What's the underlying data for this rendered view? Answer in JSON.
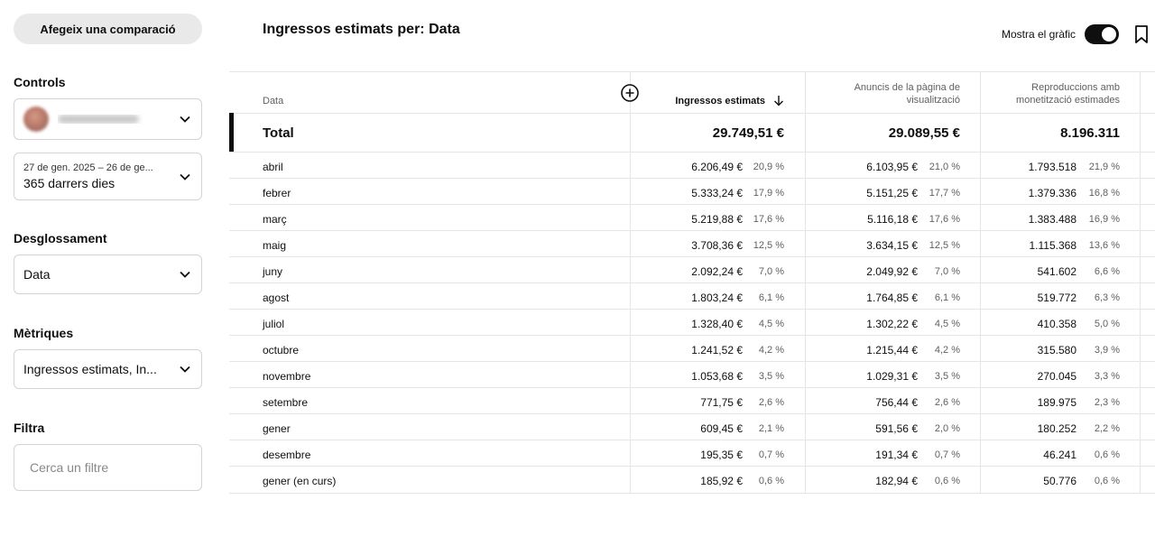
{
  "sidebar": {
    "compare_button": "Afegeix una comparació",
    "controls_label": "Controls",
    "date_range": {
      "range_text": "27 de gen. 2025 – 26 de ge...",
      "period": "365 darrers dies"
    },
    "breakdown_label": "Desglossament",
    "breakdown_value": "Data",
    "metrics_label": "Mètriques",
    "metrics_value": "Ingressos estimats, In...",
    "filter_label": "Filtra",
    "filter_placeholder": "Cerca un filtre"
  },
  "header": {
    "title": "Ingressos estimats per: Data",
    "show_chart_label": "Mostra el gràfic",
    "show_chart_on": true
  },
  "table": {
    "col_date": "Data",
    "col_revenue": "Ingressos estimats",
    "col_watch_ads_l1": "Anuncis de la pàgina de",
    "col_watch_ads_l2": "visualització",
    "col_monet_l1": "Reproduccions amb",
    "col_monet_l2": "monetització estimades",
    "total": {
      "label": "Total",
      "revenue": "29.749,51 €",
      "watch_ads": "29.089,55 €",
      "monet": "8.196.311"
    },
    "rows": [
      {
        "label": "abril",
        "rev": "6.206,49 €",
        "rev_pct": "20,9 %",
        "ads": "6.103,95 €",
        "ads_pct": "21,0 %",
        "mon": "1.793.518",
        "mon_pct": "21,9 %"
      },
      {
        "label": "febrer",
        "rev": "5.333,24 €",
        "rev_pct": "17,9 %",
        "ads": "5.151,25 €",
        "ads_pct": "17,7 %",
        "mon": "1.379.336",
        "mon_pct": "16,8 %"
      },
      {
        "label": "març",
        "rev": "5.219,88 €",
        "rev_pct": "17,6 %",
        "ads": "5.116,18 €",
        "ads_pct": "17,6 %",
        "mon": "1.383.488",
        "mon_pct": "16,9 %"
      },
      {
        "label": "maig",
        "rev": "3.708,36 €",
        "rev_pct": "12,5 %",
        "ads": "3.634,15 €",
        "ads_pct": "12,5 %",
        "mon": "1.115.368",
        "mon_pct": "13,6 %"
      },
      {
        "label": "juny",
        "rev": "2.092,24 €",
        "rev_pct": "7,0 %",
        "ads": "2.049,92 €",
        "ads_pct": "7,0 %",
        "mon": "541.602",
        "mon_pct": "6,6 %"
      },
      {
        "label": "agost",
        "rev": "1.803,24 €",
        "rev_pct": "6,1 %",
        "ads": "1.764,85 €",
        "ads_pct": "6,1 %",
        "mon": "519.772",
        "mon_pct": "6,3 %"
      },
      {
        "label": "juliol",
        "rev": "1.328,40 €",
        "rev_pct": "4,5 %",
        "ads": "1.302,22 €",
        "ads_pct": "4,5 %",
        "mon": "410.358",
        "mon_pct": "5,0 %"
      },
      {
        "label": "octubre",
        "rev": "1.241,52 €",
        "rev_pct": "4,2 %",
        "ads": "1.215,44 €",
        "ads_pct": "4,2 %",
        "mon": "315.580",
        "mon_pct": "3,9 %"
      },
      {
        "label": "novembre",
        "rev": "1.053,68 €",
        "rev_pct": "3,5 %",
        "ads": "1.029,31 €",
        "ads_pct": "3,5 %",
        "mon": "270.045",
        "mon_pct": "3,3 %"
      },
      {
        "label": "setembre",
        "rev": "771,75 €",
        "rev_pct": "2,6 %",
        "ads": "756,44 €",
        "ads_pct": "2,6 %",
        "mon": "189.975",
        "mon_pct": "2,3 %"
      },
      {
        "label": "gener",
        "rev": "609,45 €",
        "rev_pct": "2,1 %",
        "ads": "591,56 €",
        "ads_pct": "2,0 %",
        "mon": "180.252",
        "mon_pct": "2,2 %"
      },
      {
        "label": "desembre",
        "rev": "195,35 €",
        "rev_pct": "0,7 %",
        "ads": "191,34 €",
        "ads_pct": "0,7 %",
        "mon": "46.241",
        "mon_pct": "0,6 %"
      },
      {
        "label": "gener (en curs)",
        "rev": "185,92 €",
        "rev_pct": "0,6 %",
        "ads": "182,94 €",
        "ads_pct": "0,6 %",
        "mon": "50.776",
        "mon_pct": "0,6 %"
      }
    ]
  },
  "icons": {
    "chevron": "chevron-down-icon",
    "add_column": "plus-circle-icon",
    "sort": "arrow-down-icon",
    "bookmark": "bookmark-icon"
  },
  "colors": {
    "toggle_on": "#0f0f0f",
    "divider": "#e5e5e5",
    "button_bg": "#e9e9e9"
  }
}
